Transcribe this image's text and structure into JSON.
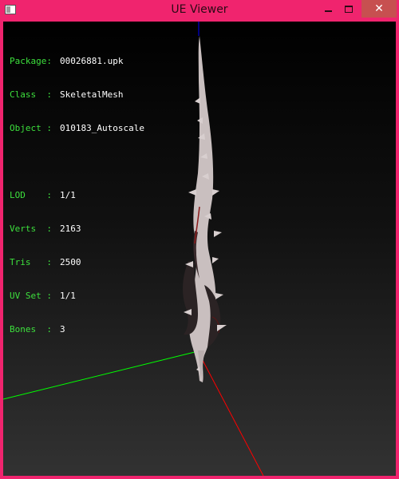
{
  "window": {
    "title": "UE Viewer",
    "controls": {
      "minimize": "minimize",
      "maximize": "maximize",
      "close": "close"
    }
  },
  "info": {
    "object_block": [
      {
        "label": "Package:",
        "value": "00026881.upk"
      },
      {
        "label": "Class  :",
        "value": "SkeletalMesh"
      },
      {
        "label": "Object :",
        "value": "010183_Autoscale"
      }
    ],
    "stats_block": [
      {
        "label": "LOD    :",
        "value": "1/1"
      },
      {
        "label": "Verts  :",
        "value": "2163"
      },
      {
        "label": "Tris   :",
        "value": "2500"
      },
      {
        "label": "UV Set :",
        "value": "1/1"
      },
      {
        "label": "Bones  :",
        "value": "3"
      }
    ]
  },
  "colors": {
    "frame": "#f0246e",
    "label_text": "#3de03d",
    "value_text": "#ffffff",
    "axis_x": "#ff0000",
    "axis_y": "#00ff00",
    "axis_z": "#0000ff",
    "mesh": "#c9bfbf"
  },
  "icons": {
    "app_icon": "window-icon",
    "minimize": "minimize-icon",
    "maximize": "maximize-icon",
    "close": "close-icon"
  }
}
